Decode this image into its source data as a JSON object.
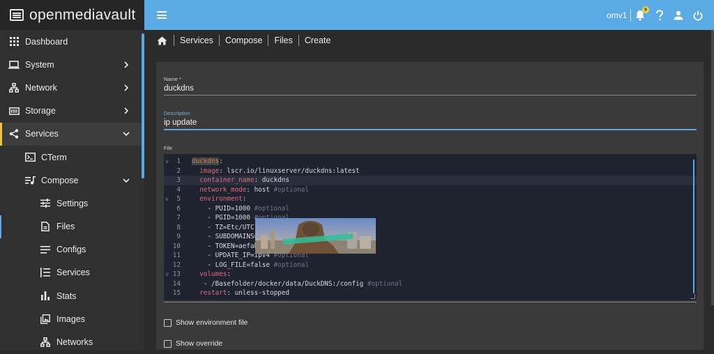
{
  "app": {
    "logo_text": "openmediavault"
  },
  "topbar": {
    "hostname": "omv1",
    "notifications_count": "9"
  },
  "sidebar": {
    "items": [
      {
        "label": "Dashboard"
      },
      {
        "label": "System"
      },
      {
        "label": "Network"
      },
      {
        "label": "Storage"
      },
      {
        "label": "Services"
      },
      {
        "label": "CTerm"
      },
      {
        "label": "Compose"
      },
      {
        "label": "Settings"
      },
      {
        "label": "Files"
      },
      {
        "label": "Configs"
      },
      {
        "label": "Services"
      },
      {
        "label": "Stats"
      },
      {
        "label": "Images"
      },
      {
        "label": "Networks"
      }
    ]
  },
  "breadcrumb": {
    "items": [
      "Services",
      "Compose",
      "Files",
      "Create"
    ]
  },
  "form": {
    "name": {
      "label": "Name *",
      "value": "duckdns"
    },
    "description": {
      "label": "Description",
      "value": "ip update"
    },
    "file": {
      "label": "File"
    },
    "show_env_label": "Show environment file",
    "show_override_label": "Show override"
  },
  "editor": {
    "lines": [
      {
        "n": "1",
        "key": "duckdns",
        "sep": ":",
        "val": "",
        "comment": "",
        "indent": ""
      },
      {
        "n": "2",
        "key": "image",
        "sep": ": ",
        "val": "lscr.io/linuxserver/duckdns:latest",
        "comment": "",
        "indent": "  "
      },
      {
        "n": "3",
        "key": "container_name",
        "sep": ": ",
        "val": "duckdns",
        "comment": "",
        "indent": "  "
      },
      {
        "n": "4",
        "key": "network_mode",
        "sep": ": ",
        "val": "host ",
        "comment": "#optional",
        "indent": "  "
      },
      {
        "n": "5",
        "key": "environment",
        "sep": ":",
        "val": "",
        "comment": "",
        "indent": "  "
      },
      {
        "n": "6",
        "key": "",
        "sep": "",
        "val": "- PUID=1000 ",
        "comment": "#optional",
        "indent": "    "
      },
      {
        "n": "7",
        "key": "",
        "sep": "",
        "val": "- PGID=1000 ",
        "comment": "#optional",
        "indent": "    "
      },
      {
        "n": "8",
        "key": "",
        "sep": "",
        "val": "- TZ=Etc/UTC",
        "comment": "",
        "indent": "    "
      },
      {
        "n": "9",
        "key": "",
        "sep": "",
        "val": "- SUBDOMAINS=",
        "comment": "",
        "indent": "    "
      },
      {
        "n": "10",
        "key": "",
        "sep": "",
        "val": "- TOKEN=aefab",
        "comment": "",
        "indent": "    "
      },
      {
        "n": "11",
        "key": "",
        "sep": "",
        "val": "- UPDATE_IP=ipv4 ",
        "comment": "#optional",
        "indent": "    "
      },
      {
        "n": "12",
        "key": "",
        "sep": "",
        "val": "- LOG_FILE=false ",
        "comment": "#optional",
        "indent": "    "
      },
      {
        "n": "13",
        "key": "volumes",
        "sep": ":",
        "val": "",
        "comment": "",
        "indent": "  "
      },
      {
        "n": "14",
        "key": "",
        "sep": "",
        "val": "- /Basefolder/docker/data/DuckDNS:/config ",
        "comment": "#optional",
        "indent": "   "
      },
      {
        "n": "15",
        "key": "restart",
        "sep": ": ",
        "val": "unless-stopped",
        "comment": "",
        "indent": "  "
      }
    ]
  },
  "colors": {
    "accent": "#5aaae6",
    "sidebar_active_marker": "#f0c43a",
    "yaml_key": "#e06c75"
  }
}
